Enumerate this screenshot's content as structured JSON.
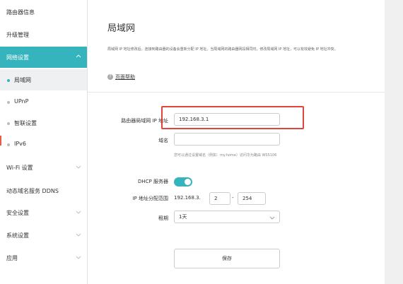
{
  "sidebar": {
    "items": [
      {
        "label": "路由器信息",
        "chevron": false
      },
      {
        "label": "升级管理",
        "chevron": false
      },
      {
        "label": "网络设置",
        "chevron": true,
        "active": true
      },
      {
        "label": "局域网",
        "sub": true,
        "selected": true
      },
      {
        "label": "UPnP",
        "sub": true
      },
      {
        "label": "智联设置",
        "sub": true
      },
      {
        "label": "IPv6",
        "sub": true
      },
      {
        "label": "Wi-Fi 设置",
        "chevron": true
      },
      {
        "label": "动态域名服务 DDNS",
        "chevron": false
      },
      {
        "label": "安全设置",
        "chevron": true
      },
      {
        "label": "系统设置",
        "chevron": true
      },
      {
        "label": "应用",
        "chevron": true
      }
    ]
  },
  "main": {
    "title": "局域网",
    "description": "局域网 IP 地址修改后，连接到路由器的设备会重新分配 IP 地址。当局域网的路由器网段相同时，修改局域网 IP 地址，可以有效避免 IP 地址冲突。",
    "help_label": "页面帮助",
    "form": {
      "lan_ip_label": "路由器局域网 IP 地址",
      "lan_ip_value": "192.168.3.1",
      "domain_label": "域名",
      "domain_value": "",
      "domain_hint": "您可以通过设置域名（例如：my.home）访问华为路由 WS5106",
      "dhcp_label": "DHCP 服务器",
      "dhcp_enabled": true,
      "ip_range_label": "IP 地址分配范围",
      "ip_range_prefix": "192.168.3.",
      "ip_range_start": "2",
      "ip_range_separator": "-",
      "ip_range_end": "254",
      "lease_label": "租期",
      "lease_value": "1天"
    },
    "save_label": "保存"
  },
  "colors": {
    "accent": "#35b4bd",
    "highlight": "#e0443a"
  }
}
